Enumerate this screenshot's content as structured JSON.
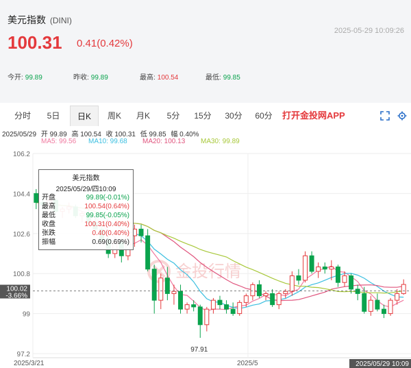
{
  "header": {
    "name": "美元指数",
    "code": "(DINI)",
    "timestamp": "2025-05-29 10:09:26",
    "price": "100.31",
    "change": "0.41(0.42%)",
    "stats": [
      {
        "label": "今开:",
        "value": "99.89",
        "tone": "green"
      },
      {
        "label": "昨收:",
        "value": "99.89",
        "tone": "green"
      },
      {
        "label": "最高:",
        "value": "100.54",
        "tone": "red"
      },
      {
        "label": "最低:",
        "value": "99.85",
        "tone": "green"
      }
    ]
  },
  "tabs": [
    "分时",
    "5日",
    "日K",
    "周K",
    "月K",
    "5分",
    "15分",
    "30分",
    "60分"
  ],
  "active_tab": "日K",
  "app_link": "打开金投网APP",
  "info_line": {
    "date": "2025/05/29",
    "open": "开 99.89",
    "high": "高 100.54",
    "close": "收 100.31",
    "low": "低 99.85",
    "amp": "幅 0.40%"
  },
  "ma_line": {
    "ma5": "MA5: 99.56",
    "ma10": "MA10: 99.68",
    "ma20": "MA20: 100.13",
    "ma30": "MA30: 99.89"
  },
  "colors": {
    "up": "#e4393c",
    "down": "#0aa34d",
    "ma5": "#f07aa0",
    "ma10": "#3bbfe0",
    "ma20": "#e0557e",
    "ma30": "#a8c83a",
    "brand": "#e4393c"
  },
  "tooltip": {
    "title": "美元指数",
    "date": "2025/05/29/四10:09",
    "rows": [
      {
        "label": "开盘",
        "value": "99.89(-0.01%)",
        "tone": "green"
      },
      {
        "label": "最高",
        "value": "100.54(0.64%)",
        "tone": "red"
      },
      {
        "label": "最低",
        "value": "99.85(-0.05%)",
        "tone": "green"
      },
      {
        "label": "收盘",
        "value": "100.31(0.40%)",
        "tone": "red"
      },
      {
        "label": "张跌",
        "value": "0.40(0.40%)",
        "tone": "red"
      },
      {
        "label": "振幅",
        "value": "0.69(0.69%)",
        "tone": "dark"
      }
    ]
  },
  "watermark": "金投行情",
  "crosshair": {
    "price": "100.02",
    "pct": "-3.66%"
  },
  "chart_data": {
    "type": "candlestick",
    "y_ticks": [
      "106.2",
      "104.4",
      "102.6",
      "100.8",
      "99",
      "97.2"
    ],
    "ylim": [
      97.2,
      106.2
    ],
    "x_labels": [
      "2025/3/21",
      "2025/5"
    ],
    "current_time": "2025/05/29 10:09",
    "min_label": "97.91",
    "grid": true,
    "candles": [
      {
        "o": 104.4,
        "h": 104.6,
        "l": 103.7,
        "c": 104.0
      },
      {
        "o": 104.0,
        "h": 104.2,
        "l": 103.6,
        "c": 103.9
      },
      {
        "o": 103.9,
        "h": 104.3,
        "l": 103.7,
        "c": 104.1
      },
      {
        "o": 104.1,
        "h": 104.2,
        "l": 103.5,
        "c": 103.6
      },
      {
        "o": 103.6,
        "h": 103.8,
        "l": 103.3,
        "c": 103.7
      },
      {
        "o": 103.7,
        "h": 104.0,
        "l": 103.5,
        "c": 103.8
      },
      {
        "o": 103.8,
        "h": 103.9,
        "l": 103.3,
        "c": 103.4
      },
      {
        "o": 103.4,
        "h": 103.6,
        "l": 103.1,
        "c": 103.5
      },
      {
        "o": 103.5,
        "h": 103.7,
        "l": 103.0,
        "c": 103.1
      },
      {
        "o": 103.1,
        "h": 103.3,
        "l": 102.6,
        "c": 102.8
      },
      {
        "o": 102.8,
        "h": 103.0,
        "l": 102.2,
        "c": 102.3
      },
      {
        "o": 102.3,
        "h": 102.5,
        "l": 101.5,
        "c": 101.7
      },
      {
        "o": 101.7,
        "h": 102.4,
        "l": 101.5,
        "c": 102.2
      },
      {
        "o": 102.2,
        "h": 102.4,
        "l": 101.3,
        "c": 101.6
      },
      {
        "o": 101.6,
        "h": 102.7,
        "l": 101.4,
        "c": 102.5
      },
      {
        "o": 102.5,
        "h": 103.0,
        "l": 102.0,
        "c": 102.8
      },
      {
        "o": 102.8,
        "h": 103.0,
        "l": 102.2,
        "c": 102.5
      },
      {
        "o": 102.5,
        "h": 102.8,
        "l": 100.9,
        "c": 101.0
      },
      {
        "o": 101.0,
        "h": 101.2,
        "l": 99.0,
        "c": 99.6
      },
      {
        "o": 99.6,
        "h": 100.8,
        "l": 99.2,
        "c": 100.6
      },
      {
        "o": 100.6,
        "h": 101.1,
        "l": 99.6,
        "c": 99.9
      },
      {
        "o": 99.9,
        "h": 100.3,
        "l": 99.4,
        "c": 100.0
      },
      {
        "o": 100.0,
        "h": 100.3,
        "l": 99.0,
        "c": 99.2
      },
      {
        "o": 99.2,
        "h": 99.5,
        "l": 99.0,
        "c": 99.4
      },
      {
        "o": 99.4,
        "h": 99.6,
        "l": 99.1,
        "c": 99.3
      },
      {
        "o": 99.3,
        "h": 99.4,
        "l": 97.91,
        "c": 98.5
      },
      {
        "o": 98.5,
        "h": 99.3,
        "l": 98.2,
        "c": 99.2
      },
      {
        "o": 99.2,
        "h": 99.7,
        "l": 99.0,
        "c": 99.6
      },
      {
        "o": 99.6,
        "h": 99.8,
        "l": 99.2,
        "c": 99.4
      },
      {
        "o": 99.4,
        "h": 99.6,
        "l": 99.0,
        "c": 99.2
      },
      {
        "o": 99.2,
        "h": 99.5,
        "l": 98.9,
        "c": 99.0
      },
      {
        "o": 99.0,
        "h": 99.6,
        "l": 98.9,
        "c": 99.5
      },
      {
        "o": 99.5,
        "h": 99.9,
        "l": 99.3,
        "c": 99.8
      },
      {
        "o": 99.8,
        "h": 100.4,
        "l": 99.6,
        "c": 100.3
      },
      {
        "o": 100.3,
        "h": 100.5,
        "l": 99.7,
        "c": 99.8
      },
      {
        "o": 99.8,
        "h": 100.0,
        "l": 99.6,
        "c": 99.9
      },
      {
        "o": 99.9,
        "h": 100.1,
        "l": 99.3,
        "c": 99.4
      },
      {
        "o": 99.4,
        "h": 100.0,
        "l": 99.2,
        "c": 99.9
      },
      {
        "o": 99.9,
        "h": 100.1,
        "l": 99.7,
        "c": 100.0
      },
      {
        "o": 100.0,
        "h": 100.9,
        "l": 99.8,
        "c": 100.7
      },
      {
        "o": 100.7,
        "h": 101.0,
        "l": 100.3,
        "c": 100.5
      },
      {
        "o": 100.5,
        "h": 101.8,
        "l": 100.4,
        "c": 101.6
      },
      {
        "o": 101.6,
        "h": 101.8,
        "l": 100.8,
        "c": 100.9
      },
      {
        "o": 100.9,
        "h": 101.3,
        "l": 100.6,
        "c": 101.1
      },
      {
        "o": 101.1,
        "h": 101.3,
        "l": 100.8,
        "c": 101.0
      },
      {
        "o": 101.0,
        "h": 101.4,
        "l": 100.5,
        "c": 101.1
      },
      {
        "o": 101.1,
        "h": 101.2,
        "l": 100.2,
        "c": 100.4
      },
      {
        "o": 100.4,
        "h": 100.9,
        "l": 100.2,
        "c": 100.7
      },
      {
        "o": 100.7,
        "h": 100.8,
        "l": 99.9,
        "c": 100.1
      },
      {
        "o": 100.1,
        "h": 100.3,
        "l": 99.6,
        "c": 99.9
      },
      {
        "o": 99.9,
        "h": 100.2,
        "l": 99.0,
        "c": 99.1
      },
      {
        "o": 99.1,
        "h": 99.8,
        "l": 98.9,
        "c": 99.6
      },
      {
        "o": 99.6,
        "h": 99.9,
        "l": 99.1,
        "c": 99.2
      },
      {
        "o": 99.2,
        "h": 99.4,
        "l": 98.8,
        "c": 99.0
      },
      {
        "o": 99.0,
        "h": 99.7,
        "l": 98.9,
        "c": 99.6
      },
      {
        "o": 99.6,
        "h": 100.1,
        "l": 99.4,
        "c": 99.9
      },
      {
        "o": 99.9,
        "h": 100.54,
        "l": 99.85,
        "c": 100.31
      }
    ]
  }
}
